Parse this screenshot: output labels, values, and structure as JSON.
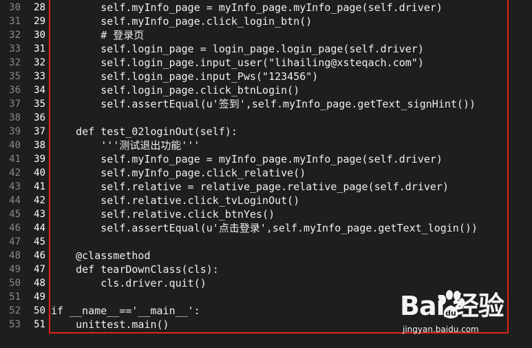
{
  "editor": {
    "lines": [
      {
        "outer": "30",
        "inner": "28",
        "code": "        self.myInfo_page = myInfo_page.myInfo_page(self.driver)"
      },
      {
        "outer": "31",
        "inner": "29",
        "code": "        self.myInfo_page.click_login_btn()"
      },
      {
        "outer": "32",
        "inner": "30",
        "code": "        # 登录页"
      },
      {
        "outer": "33",
        "inner": "31",
        "code": "        self.login_page = login_page.login_page(self.driver)"
      },
      {
        "outer": "32",
        "inner": "32",
        "code": "        self.login_page.input_user(\"lihailing@xsteqach.com\")"
      },
      {
        "outer": "35",
        "inner": "33",
        "code": "        self.login_page.input_Pws(\"123456\")"
      },
      {
        "outer": "36",
        "inner": "34",
        "code": "        self.login_page.click_btnLogin()"
      },
      {
        "outer": "37",
        "inner": "35",
        "code": "        self.assertEqual(u'签到',self.myInfo_page.getText_signHint())"
      },
      {
        "outer": "38",
        "inner": "36",
        "code": ""
      },
      {
        "outer": "39",
        "inner": "37",
        "code": "    def test_02loginOut(self):"
      },
      {
        "outer": "40",
        "inner": "38",
        "code": "        '''测试退出功能'''"
      },
      {
        "outer": "41",
        "inner": "39",
        "code": "        self.myInfo_page = myInfo_page.myInfo_page(self.driver)"
      },
      {
        "outer": "42",
        "inner": "40",
        "code": "        self.myInfo_page.click_relative()"
      },
      {
        "outer": "43",
        "inner": "41",
        "code": "        self.relative = relative_page.relative_page(self.driver)"
      },
      {
        "outer": "44",
        "inner": "42",
        "code": "        self.relative.click_tvLoginOut()"
      },
      {
        "outer": "45",
        "inner": "43",
        "code": "        self.relative.click_btnYes()"
      },
      {
        "outer": "46",
        "inner": "44",
        "code": "        self.assertEqual(u'点击登录',self.myInfo_page.getText_login())"
      },
      {
        "outer": "47",
        "inner": "45",
        "code": ""
      },
      {
        "outer": "48",
        "inner": "46",
        "code": "    @classmethod"
      },
      {
        "outer": "49",
        "inner": "47",
        "code": "    def tearDownClass(cls):"
      },
      {
        "outer": "50",
        "inner": "48",
        "code": "        cls.driver.quit()"
      },
      {
        "outer": "51",
        "inner": "49",
        "code": ""
      },
      {
        "outer": "52",
        "inner": "50",
        "code": "if __name__=='__main__':"
      },
      {
        "outer": "53",
        "inner": "51",
        "code": "    unittest.main()"
      }
    ]
  },
  "watermark": {
    "logo_text": "Bai  经验",
    "url": "jingyan.baidu.com",
    "icon": "baidu-paw-icon"
  },
  "colors": {
    "background": "#1e1e1e",
    "highlight_border": "#e0251b",
    "line_number_outer": "#8a8a8a",
    "line_number_inner": "#ffffff",
    "code_text": "#f0f0f0"
  }
}
